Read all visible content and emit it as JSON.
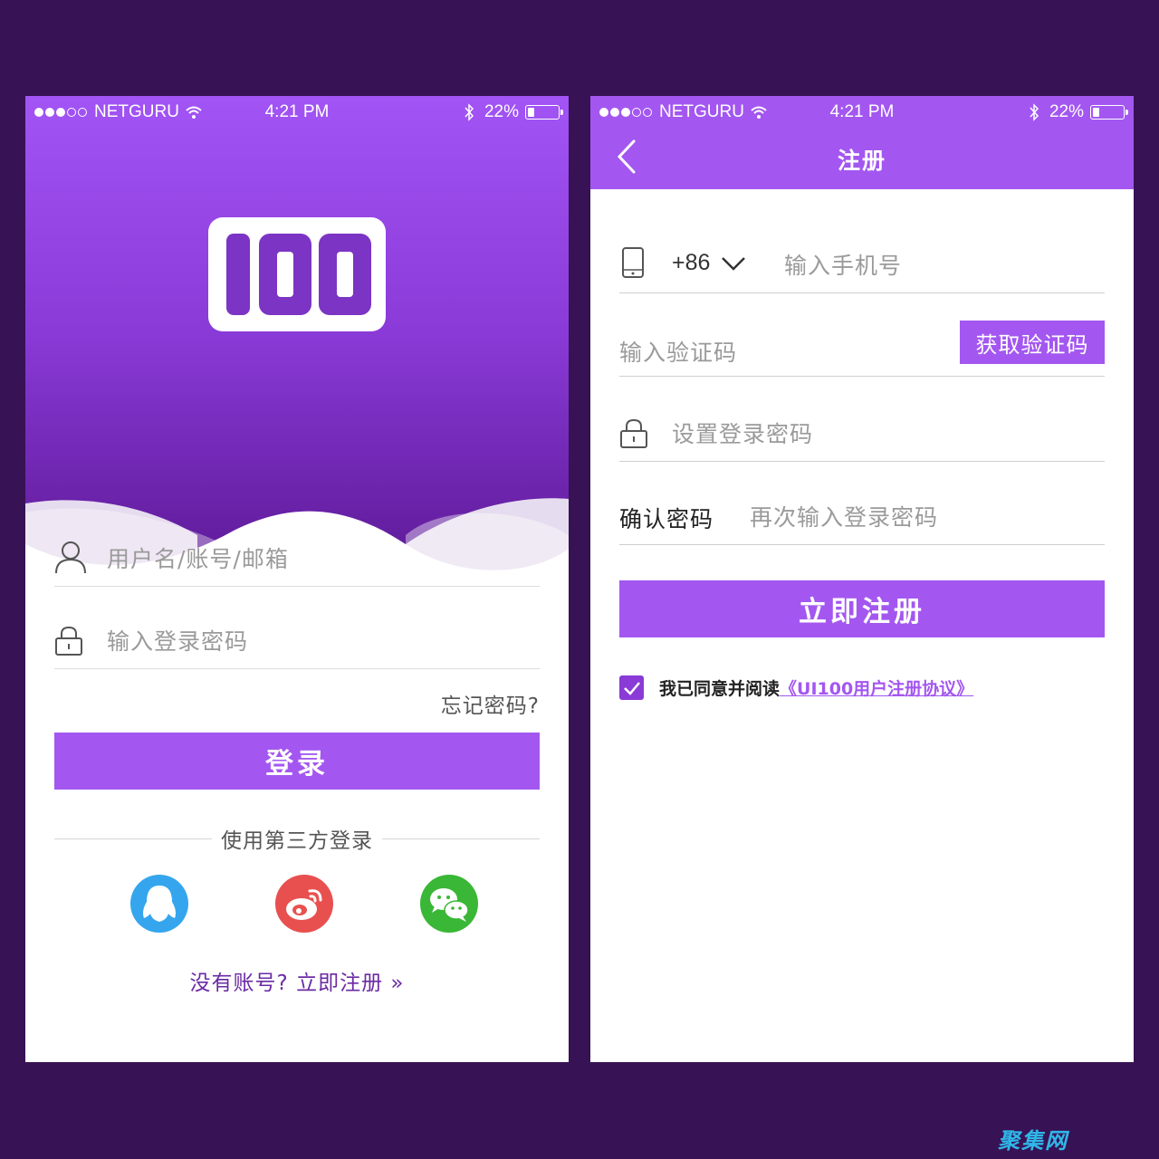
{
  "status_bar": {
    "carrier": "NETGURU",
    "time": "4:21 PM",
    "battery": "22%",
    "battery_level": 0.22
  },
  "login": {
    "logo_text": "100",
    "username_placeholder": "用户名/账号/邮箱",
    "password_placeholder": "输入登录密码",
    "forgot_password": "忘记密码?",
    "login_button": "登录",
    "third_party_label": "使用第三方登录",
    "social": [
      {
        "name": "qq",
        "icon": "qq-penguin-icon",
        "color": "#35a6ee"
      },
      {
        "name": "weibo",
        "icon": "weibo-icon",
        "color": "#e8504f"
      },
      {
        "name": "wechat",
        "icon": "wechat-icon",
        "color": "#3ab736"
      }
    ],
    "no_account": "没有账号?",
    "register_now": "立即注册",
    "register_arrow": "»"
  },
  "register": {
    "title": "注册",
    "country_code": "+86",
    "phone_placeholder": "输入手机号",
    "code_placeholder": "输入验证码",
    "get_code_button": "获取验证码",
    "password_placeholder": "设置登录密码",
    "confirm_label": "确认密码",
    "confirm_placeholder": "再次输入登录密码",
    "register_button": "立即注册",
    "agree_text": "我已同意并阅读",
    "agreement_link": "《UI100用户注册协议》",
    "agree_checked": true
  },
  "colors": {
    "background": "#371255",
    "accent": "#a357f0",
    "header_top": "#a254f5",
    "header_bottom": "#5e1a98"
  },
  "watermark": "聚集网"
}
